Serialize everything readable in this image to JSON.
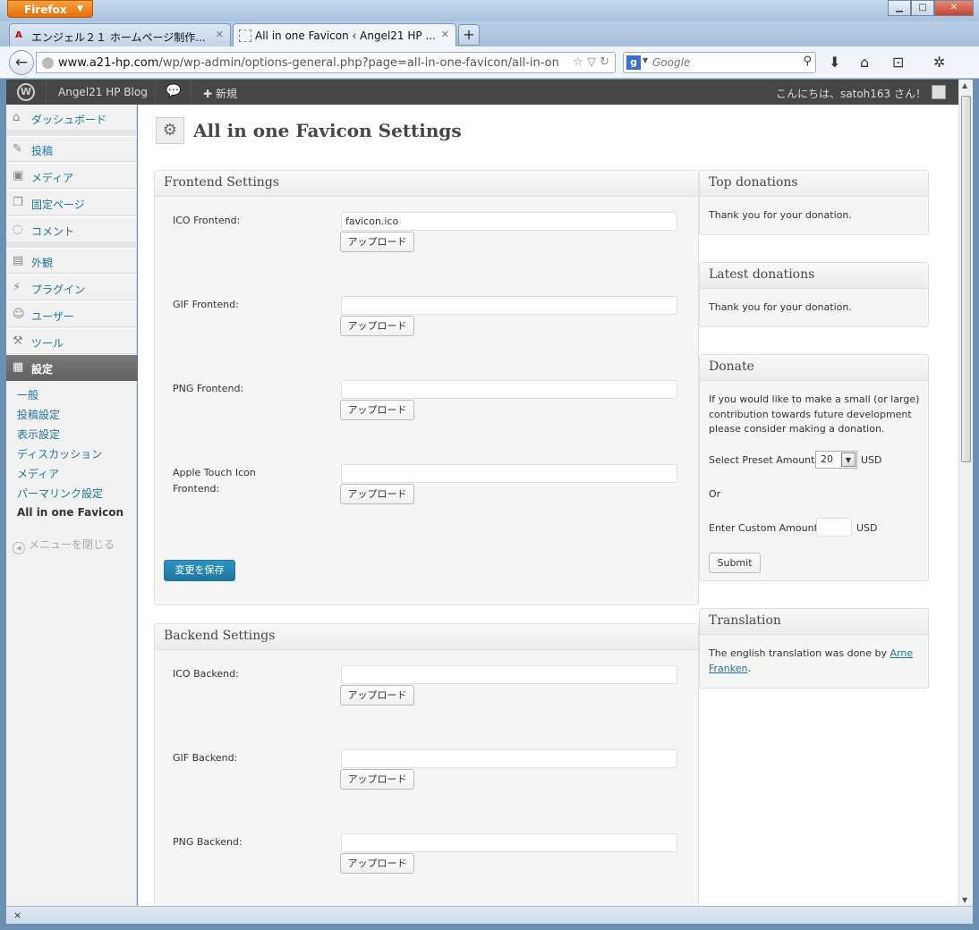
{
  "browser": {
    "menu_label": "Firefox",
    "tabs": [
      {
        "title": "エンジェル２１ ホームページ制作..."
      },
      {
        "title": "All in one Favicon ‹ Angel21 HP ..."
      }
    ],
    "url_host": "www.a21-hp.com",
    "url_path": "/wp/wp-admin/options-general.php?page=all-in-one-favicon/all-in-one-favic",
    "search_placeholder": "Google",
    "status_text": "×"
  },
  "wp_toolbar": {
    "site_name": "Angel21 HP Blog",
    "new_label": "新規",
    "greeting": "こんにちは、satoh163 さん！"
  },
  "admin_menu": {
    "items": [
      {
        "label": "ダッシュボード",
        "icon": "dashboard-icon"
      },
      {
        "label": "投稿",
        "icon": "pin-icon"
      },
      {
        "label": "メディア",
        "icon": "media-icon"
      },
      {
        "label": "固定ページ",
        "icon": "pages-icon"
      },
      {
        "label": "コメント",
        "icon": "comment-icon"
      },
      {
        "label": "外観",
        "icon": "appearance-icon"
      },
      {
        "label": "プラグイン",
        "icon": "plugin-icon"
      },
      {
        "label": "ユーザー",
        "icon": "users-icon"
      },
      {
        "label": "ツール",
        "icon": "tools-icon"
      },
      {
        "label": "設定",
        "icon": "settings-icon"
      }
    ],
    "submenu": [
      "一般",
      "投稿設定",
      "表示設定",
      "ディスカッション",
      "メディア",
      "パーマリンク設定",
      "All in one Favicon"
    ],
    "collapse_label": "メニューを閉じる"
  },
  "page": {
    "title": "All in one Favicon Settings"
  },
  "frontend": {
    "heading": "Frontend Settings",
    "fields": [
      {
        "label": "ICO Frontend:",
        "value": "favicon.ico"
      },
      {
        "label": "GIF Frontend:",
        "value": ""
      },
      {
        "label": "PNG Frontend:",
        "value": ""
      },
      {
        "label_line1": "Apple Touch Icon",
        "label_line2": "Frontend:",
        "value": ""
      }
    ],
    "upload_label": "アップロード",
    "save_label": "変更を保存"
  },
  "backend": {
    "heading": "Backend Settings",
    "fields": [
      {
        "label": "ICO Backend:",
        "value": ""
      },
      {
        "label": "GIF Backend:",
        "value": ""
      },
      {
        "label": "PNG Backend:",
        "value": ""
      }
    ],
    "upload_label": "アップロード"
  },
  "sidebar": {
    "top_donations": {
      "title": "Top donations",
      "text": "Thank you for your donation."
    },
    "latest_donations": {
      "title": "Latest donations",
      "text": "Thank you for your donation."
    },
    "donate": {
      "title": "Donate",
      "text_lines": [
        "If you would like to make a small (or large)",
        "contribution towards future development",
        "please consider making a donation."
      ],
      "preset_label": "Select Preset Amount:",
      "preset_value": "20",
      "currency": "USD",
      "or_label": "Or",
      "custom_label": "Enter Custom Amount:",
      "submit_label": "Submit"
    },
    "translation": {
      "title": "Translation",
      "text_before": "The english translation was done by",
      "link_line1": "Arne",
      "link_line2": "Franken",
      "text_after": "."
    }
  }
}
